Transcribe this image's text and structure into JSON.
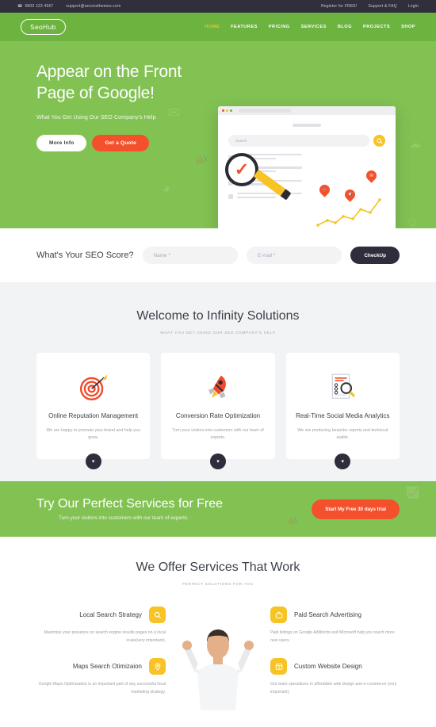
{
  "topbar": {
    "phone": "0800 123 4567",
    "email": "support@ancorathemes.com",
    "phone_icon": "phone-icon",
    "links": [
      "Register for FREE!",
      "Support & FAQ",
      "Login"
    ]
  },
  "nav": {
    "logo": "SeoHub",
    "items": [
      {
        "label": "HOME",
        "active": true
      },
      {
        "label": "FEATURES",
        "active": false
      },
      {
        "label": "PRICING",
        "active": false
      },
      {
        "label": "SERVICES",
        "active": false
      },
      {
        "label": "BLOG",
        "active": false
      },
      {
        "label": "PROJECTS",
        "active": false
      },
      {
        "label": "SHOP",
        "active": false
      }
    ],
    "active_color": "#f7c325",
    "bg_color": "#6cb33f"
  },
  "hero": {
    "title_line1": "Appear on the Front",
    "title_line2": "Page of Google!",
    "subtitle": "What You Get Using Our SEO Company's Help",
    "btn_primary": "More Info",
    "btn_secondary": "Get a Quote",
    "bg_color": "#82c253",
    "accent_color": "#f4502b",
    "browser": {
      "search_placeholder": "Search",
      "search_icon": "search-icon",
      "magnifier_icon": "magnifier-check-icon",
      "pencil_icon": "pencil-icon",
      "pins": [
        "cart-icon",
        "megaphone-icon",
        "mail-icon"
      ],
      "chart_icon": "line-chart-icon"
    }
  },
  "seoscore": {
    "title": "What's Your SEO Score?",
    "name_placeholder": "Name *",
    "name_value": "",
    "email_placeholder": "E-mail *",
    "email_value": "",
    "button": "CheckUp"
  },
  "welcome": {
    "title": "Welcome to Infinity Solutions",
    "subtitle": "WHAT YOU GET USING OUR SEO COMPANY'S HELP",
    "cards": [
      {
        "icon": "target-dart-icon",
        "title": "Online Reputation Management",
        "text": "We are happy to promote your brand and help you grow.",
        "chevron": "chevron-down-icon"
      },
      {
        "icon": "rocket-icon",
        "title": "Conversion Rate Optimization",
        "text": "Turn your visitors into customers with our team of experts.",
        "chevron": "chevron-down-icon"
      },
      {
        "icon": "document-magnifier-icon",
        "title": "Real-Time Social Media Analytics",
        "text": "We are producing bespoke reports and technical audits.",
        "chevron": "chevron-down-icon"
      }
    ]
  },
  "cta": {
    "title": "Try Our Perfect Services for Free",
    "subtitle": "Turn your visitors into customers with our team of experts.",
    "button": "Start My Free 30 days trial",
    "bg_color": "#82c253",
    "button_color": "#f4502b"
  },
  "services": {
    "title": "We Offer Services That Work",
    "subtitle": "PERFECT SOLUTIONS FOR YOU",
    "icon_color": "#f7c325",
    "left": [
      {
        "icon": "search-icon",
        "title": "Local Search Strategy",
        "text": "Maximize your presence on search engine results pages on a local scale(very important)."
      },
      {
        "icon": "map-pin-icon",
        "title": "Maps Search Otimizaion",
        "text": "Google Maps Optimization is an important part of any successful local marketing strategy."
      }
    ],
    "right": [
      {
        "icon": "briefcase-icon",
        "title": "Paid Search Advertising",
        "text": "Paid listings on Google AdWords and Microsoft help you reach more new users."
      },
      {
        "icon": "window-layout-icon",
        "title": "Custom Website Design",
        "text": "Our team specializes in affordable web design and e-commerce (very important)."
      }
    ],
    "center_image": "celebrating-man-photo"
  }
}
